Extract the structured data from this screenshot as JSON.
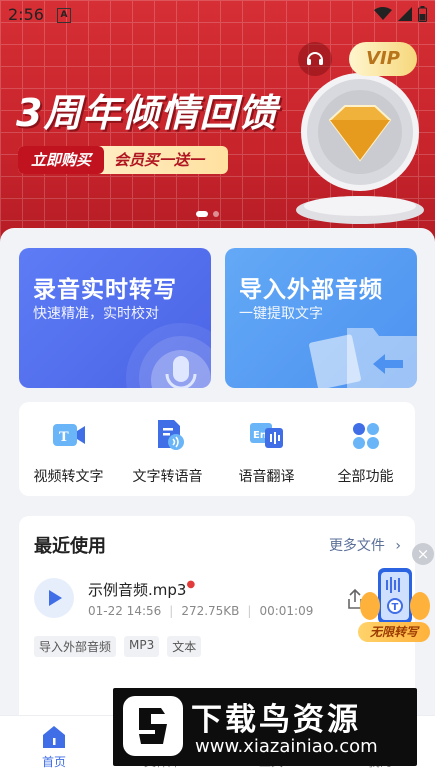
{
  "status_bar": {
    "time": "2:56",
    "notif_letter": "A"
  },
  "banner": {
    "headline": "3周年倾情回馈",
    "buy_now": "立即购买",
    "promo": "会员买一送一",
    "vip_label": "VIP",
    "emblem_label": "VIP"
  },
  "cards": {
    "record": {
      "title": "录音实时转写",
      "subtitle": "快速精准，实时校对"
    },
    "import": {
      "title": "导入外部音频",
      "subtitle": "一键提取文字"
    }
  },
  "tools": [
    {
      "label": "视频转文字",
      "icon": "video-to-text-icon"
    },
    {
      "label": "文字转语音",
      "icon": "text-to-speech-icon"
    },
    {
      "label": "语音翻译",
      "icon": "speech-translate-icon"
    },
    {
      "label": "全部功能",
      "icon": "all-features-icon"
    }
  ],
  "recent": {
    "title": "最近使用",
    "more": "更多文件",
    "file": {
      "name": "示例音频.mp3",
      "date": "01-22 14:56",
      "size": "272.75KB",
      "duration": "00:01:09",
      "tags": [
        "导入外部音频",
        "MP3",
        "文本"
      ]
    }
  },
  "float_promo": {
    "label": "无限转写"
  },
  "nav": [
    {
      "label": "首页",
      "active": true
    },
    {
      "label": "文件库",
      "active": false
    },
    {
      "label": "工具",
      "active": false
    },
    {
      "label": "我的",
      "active": false
    }
  ],
  "watermark": {
    "title": "下载鸟资源",
    "url": "www.xiazainiao.com"
  },
  "colors": {
    "primary": "#3f6ee6",
    "banner_red": "#c8242c",
    "card_blue": "#4b64e6",
    "card_light_blue": "#4d92f0"
  }
}
